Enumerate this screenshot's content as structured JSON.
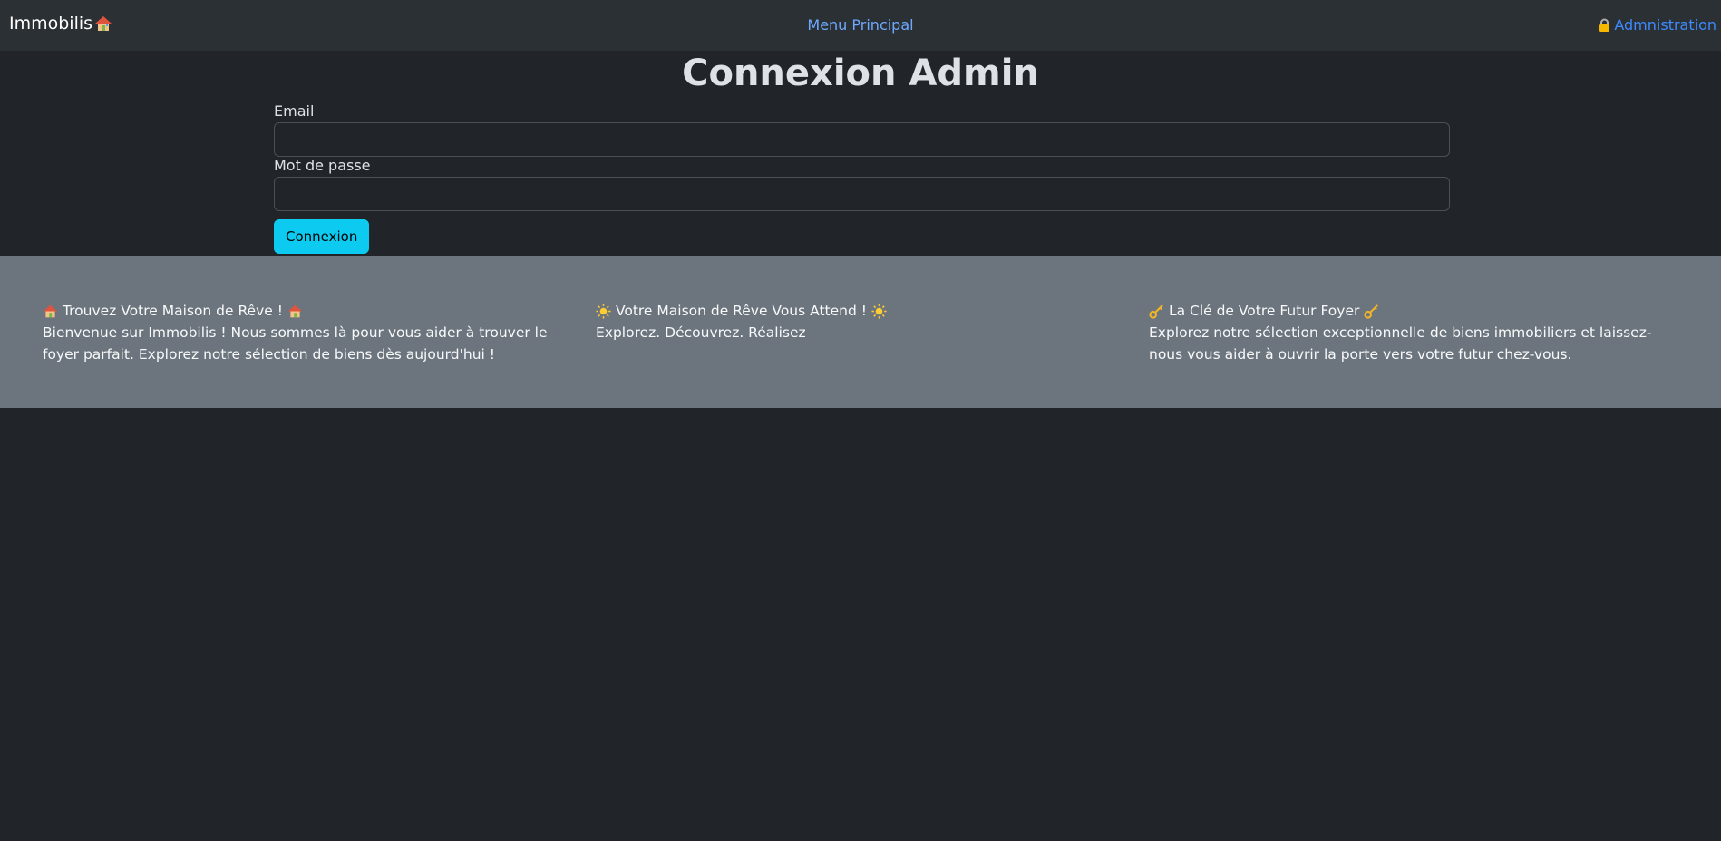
{
  "navbar": {
    "brand": "Immobilis",
    "brand_icon": "house-icon",
    "menu_link": "Menu Principal",
    "admin_link": "Admnistration",
    "admin_icon": "lock-icon"
  },
  "login": {
    "title": "Connexion Admin",
    "email_label": "Email",
    "email_value": "",
    "password_label": "Mot de passe",
    "password_value": "",
    "submit_label": "Connexion"
  },
  "banner": {
    "columns": [
      {
        "title": "Trouvez Votre Maison de Rêve !",
        "icon": "house-icon",
        "text": "Bienvenue sur Immobilis ! Nous sommes là pour vous aider à trouver le foyer parfait. Explorez notre sélection de biens dès aujourd'hui !"
      },
      {
        "title": "Votre Maison de Rêve Vous Attend !",
        "icon": "sun-icon",
        "text": "Explorez. Découvrez. Réalisez"
      },
      {
        "title": "La Clé de Votre Futur Foyer",
        "icon": "key-icon",
        "text": "Explorez notre sélection exceptionnelle de biens immobiliers et laissez-nous vous aider à ouvrir la porte vers votre futur chez-vous."
      }
    ]
  },
  "colors": {
    "background": "#212529",
    "navbar": "#2b3035",
    "link": "#6ea8fe",
    "button": "#0dcaf0",
    "banner": "#6c757d"
  }
}
